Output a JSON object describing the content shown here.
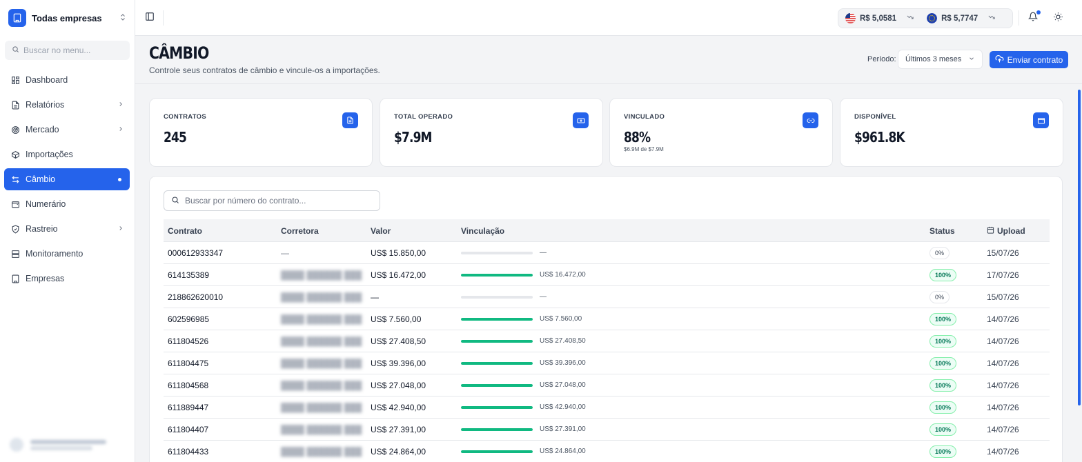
{
  "sidebar": {
    "company": "Todas empresas",
    "search_placeholder": "Buscar no menu...",
    "items": [
      {
        "label": "Dashboard",
        "icon": "dashboard-icon",
        "has_children": false
      },
      {
        "label": "Relatórios",
        "icon": "file-text-icon",
        "has_children": true
      },
      {
        "label": "Mercado",
        "icon": "radar-icon",
        "has_children": true
      },
      {
        "label": "Importações",
        "icon": "package-icon",
        "has_children": false
      },
      {
        "label": "Câmbio",
        "icon": "exchange-icon",
        "has_children": false,
        "active": true
      },
      {
        "label": "Numerário",
        "icon": "wallet-icon",
        "has_children": false
      },
      {
        "label": "Rastreio",
        "icon": "shield-icon",
        "has_children": true
      },
      {
        "label": "Monitoramento",
        "icon": "monitor-icon",
        "has_children": false
      },
      {
        "label": "Empresas",
        "icon": "building-icon",
        "has_children": false
      }
    ]
  },
  "topbar": {
    "rates": [
      {
        "label": "R$ 5,0581",
        "flag": "us-flag-icon"
      },
      {
        "label": "R$ 5,7747",
        "flag": "eu-flag-icon"
      }
    ]
  },
  "page": {
    "title": "CÂMBIO",
    "subtitle": "Controle seus contratos de câmbio e vincule-os a importações.",
    "period_label": "Período:",
    "period_value": "Últimos 3 meses",
    "upload_button": "Enviar contrato"
  },
  "stats": [
    {
      "label": "CONTRATOS",
      "value": "245",
      "sub": "",
      "icon": "document-icon"
    },
    {
      "label": "TOTAL OPERADO",
      "value": "$7.9M",
      "sub": "",
      "icon": "banknote-icon"
    },
    {
      "label": "VINCULADO",
      "value": "88%",
      "sub": "$6.9M de $7.9M",
      "icon": "link-icon"
    },
    {
      "label": "DISPONÍVEL",
      "value": "$961.8K",
      "sub": "",
      "icon": "wallet-icon"
    }
  ],
  "table": {
    "search_placeholder": "Buscar por número do contrato...",
    "columns": {
      "contrato": "Contrato",
      "corretora": "Corretora",
      "valor": "Valor",
      "vinculacao": "Vinculação",
      "status": "Status",
      "upload": "Upload"
    },
    "rows": [
      {
        "contrato": "000612933347",
        "corretora": "—",
        "corretora_blurred": false,
        "valor": "US$ 15.850,00",
        "progress": 0,
        "vinculado": "—",
        "status": "0%",
        "upload": "15/07/26"
      },
      {
        "contrato": "614135389",
        "corretora": "",
        "corretora_blurred": true,
        "valor": "US$ 16.472,00",
        "progress": 100,
        "vinculado": "US$ 16.472,00",
        "status": "100%",
        "upload": "17/07/26"
      },
      {
        "contrato": "218862620010",
        "corretora": "",
        "corretora_blurred": true,
        "valor": "—",
        "progress": 0,
        "vinculado": "—",
        "status": "0%",
        "upload": "15/07/26"
      },
      {
        "contrato": "602596985",
        "corretora": "",
        "corretora_blurred": true,
        "valor": "US$ 7.560,00",
        "progress": 100,
        "vinculado": "US$ 7.560,00",
        "status": "100%",
        "upload": "14/07/26"
      },
      {
        "contrato": "611804526",
        "corretora": "",
        "corretora_blurred": true,
        "valor": "US$ 27.408,50",
        "progress": 100,
        "vinculado": "US$ 27.408,50",
        "status": "100%",
        "upload": "14/07/26"
      },
      {
        "contrato": "611804475",
        "corretora": "",
        "corretora_blurred": true,
        "valor": "US$ 39.396,00",
        "progress": 100,
        "vinculado": "US$ 39.396,00",
        "status": "100%",
        "upload": "14/07/26"
      },
      {
        "contrato": "611804568",
        "corretora": "",
        "corretora_blurred": true,
        "valor": "US$ 27.048,00",
        "progress": 100,
        "vinculado": "US$ 27.048,00",
        "status": "100%",
        "upload": "14/07/26"
      },
      {
        "contrato": "611889447",
        "corretora": "",
        "corretora_blurred": true,
        "valor": "US$ 42.940,00",
        "progress": 100,
        "vinculado": "US$ 42.940,00",
        "status": "100%",
        "upload": "14/07/26"
      },
      {
        "contrato": "611804407",
        "corretora": "",
        "corretora_blurred": true,
        "valor": "US$ 27.391,00",
        "progress": 100,
        "vinculado": "US$ 27.391,00",
        "status": "100%",
        "upload": "14/07/26"
      },
      {
        "contrato": "611804433",
        "corretora": "",
        "corretora_blurred": true,
        "valor": "US$ 24.864,00",
        "progress": 100,
        "vinculado": "US$ 24.864,00",
        "status": "100%",
        "upload": "14/07/26"
      }
    ]
  },
  "colors": {
    "accent": "#2563eb",
    "success": "#10b981",
    "bg": "#f3f4f6"
  }
}
